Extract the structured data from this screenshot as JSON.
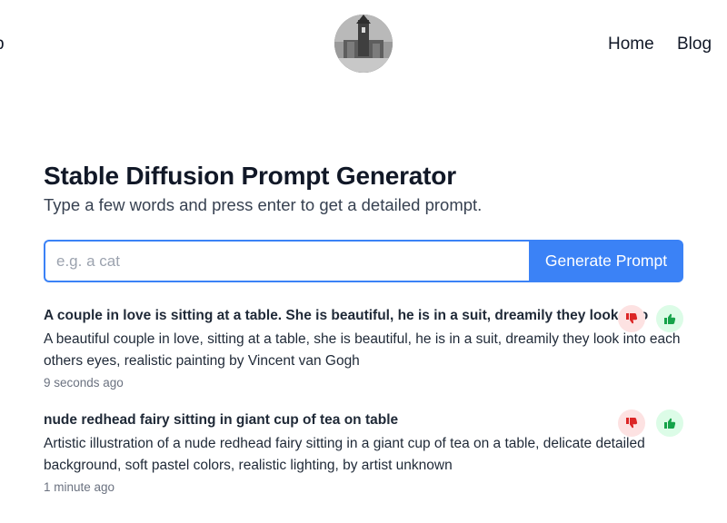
{
  "header": {
    "brand_fragment": "p",
    "nav": [
      {
        "label": "Home"
      },
      {
        "label": "Blog"
      }
    ]
  },
  "main": {
    "title": "Stable Diffusion Prompt Generator",
    "subtitle": "Type a few words and press enter to get a detailed prompt.",
    "input": {
      "placeholder": "e.g. a cat",
      "value": ""
    },
    "generate_label": "Generate Prompt"
  },
  "results": [
    {
      "input": "A couple in love is sitting at a table. She is beautiful, he is in a suit, dreamily they look into",
      "output": "A beautiful couple in love, sitting at a table, she is beautiful, he is in a suit, dreamily they look into each others eyes, realistic painting by Vincent van Gogh",
      "time": "9 seconds ago"
    },
    {
      "input": "nude redhead fairy sitting in giant cup of tea on table",
      "output": "Artistic illustration of a nude redhead fairy sitting in a giant cup of tea on a table, delicate detailed background, soft pastel colors, realistic lighting, by artist unknown",
      "time": "1 minute ago"
    }
  ],
  "icons": {
    "thumbs_down": "thumbs-down-icon",
    "thumbs_up": "thumbs-up-icon"
  },
  "colors": {
    "accent": "#3b82f6",
    "downvote": "#dc2626",
    "upvote": "#16a34a"
  }
}
